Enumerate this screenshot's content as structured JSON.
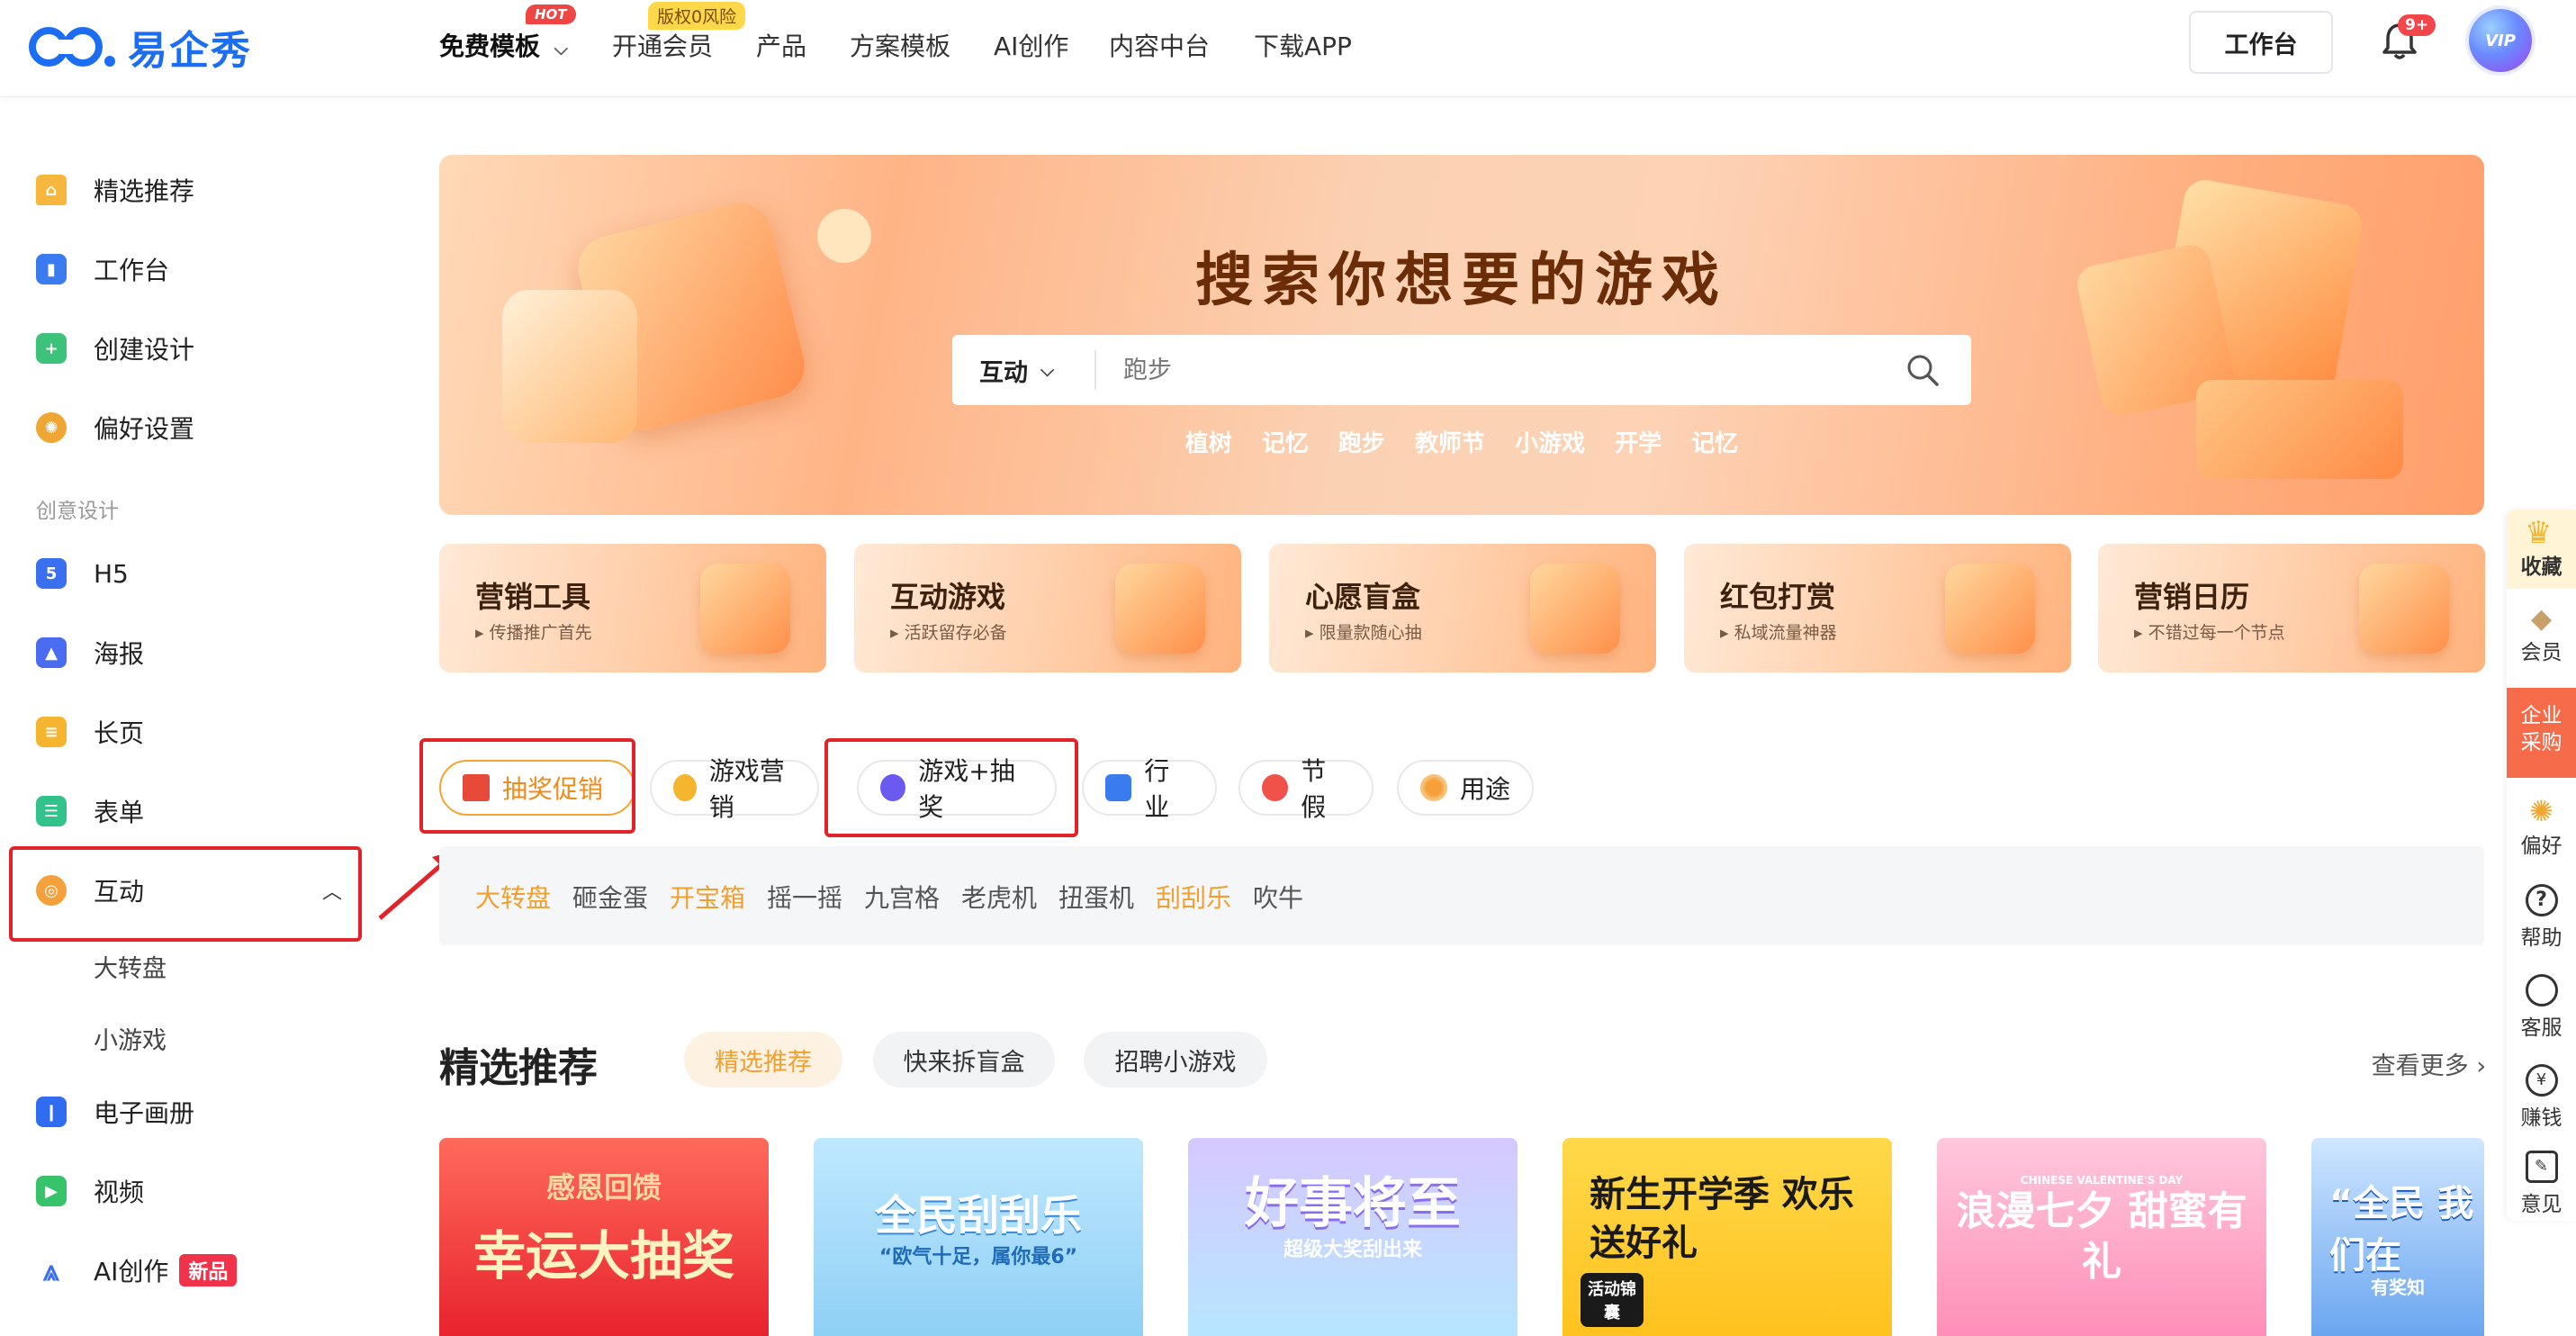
{
  "header": {
    "logo_text": "易企秀",
    "nav": [
      {
        "label": "免费模板",
        "badge": "HOT"
      },
      {
        "label": "开通会员",
        "badge": "版权0风险"
      },
      {
        "label": "产品"
      },
      {
        "label": "方案模板"
      },
      {
        "label": "AI创作"
      },
      {
        "label": "内容中台"
      },
      {
        "label": "下载APP"
      }
    ],
    "workbench_label": "工作台",
    "notif_count": "9+",
    "avatar_text": "VIP"
  },
  "sidebar": {
    "items": [
      {
        "label": "精选推荐",
        "color": "#f6b73c"
      },
      {
        "label": "工作台",
        "color": "#3a7bf0"
      },
      {
        "label": "创建设计",
        "color": "#3cc27a"
      },
      {
        "label": "偏好设置",
        "color": "#f0a632"
      }
    ],
    "section_label": "创意设计",
    "design_items": [
      {
        "label": "H5",
        "color": "#3a6ff0"
      },
      {
        "label": "海报",
        "color": "#4a6cf0"
      },
      {
        "label": "长页",
        "color": "#f5b52e"
      },
      {
        "label": "表单",
        "color": "#32c38a"
      },
      {
        "label": "互动",
        "color": "#f5a03a"
      }
    ],
    "sub_items": [
      "大转盘",
      "小游戏"
    ],
    "bottom_items": [
      {
        "label": "电子画册",
        "color": "#2f6cf0"
      },
      {
        "label": "视频",
        "color": "#36c36a"
      },
      {
        "label": "AI创作",
        "color": "#3a6ff0",
        "badge": "新品"
      }
    ]
  },
  "banner": {
    "title": "搜索你想要的游戏",
    "search_category": "互动",
    "search_placeholder": "跑步",
    "hot_words": [
      "植树",
      "记忆",
      "跑步",
      "教师节",
      "小游戏",
      "开学",
      "记忆"
    ]
  },
  "feature_cards": [
    {
      "title": "营销工具",
      "subtitle": "▸ 传播推广首先"
    },
    {
      "title": "互动游戏",
      "subtitle": "▸ 活跃留存必备"
    },
    {
      "title": "心愿盲盒",
      "subtitle": "▸ 限量款随心抽"
    },
    {
      "title": "红包打赏",
      "subtitle": "▸ 私域流量神器"
    },
    {
      "title": "营销日历",
      "subtitle": "▸ 不错过每一个节点"
    }
  ],
  "category_pills": [
    {
      "label": "抽奖促销",
      "active": true
    },
    {
      "label": "游戏营销"
    },
    {
      "label": "游戏+抽奖"
    },
    {
      "label": "行业"
    },
    {
      "label": "节假"
    },
    {
      "label": "用途"
    }
  ],
  "sub_categories": [
    "大转盘",
    "砸金蛋",
    "开宝箱",
    "摇一摇",
    "九宫格",
    "老虎机",
    "扭蛋机",
    "刮刮乐",
    "吹牛"
  ],
  "recommend": {
    "title": "精选推荐",
    "tabs": [
      "精选推荐",
      "快来拆盲盒",
      "招聘小游戏"
    ],
    "more": "查看更多 ›",
    "thumbs": [
      {
        "title": "幸运大抽奖",
        "sub": "感恩回馈"
      },
      {
        "title": "全民刮刮乐",
        "sub": "“欧气十足，属你最6”"
      },
      {
        "title": "好事将至",
        "sub": "超级大奖刮出来"
      },
      {
        "title": "新生开学季 欢乐送好礼",
        "sub": "活动锦囊"
      },
      {
        "title": "浪漫七夕 甜蜜有礼",
        "sub": "CHINESE VALENTINE'S DAY"
      },
      {
        "title": "“全民 我们在",
        "sub": "有奖知"
      }
    ]
  },
  "right_rail": [
    "收藏",
    "会员",
    "企业采购",
    "偏好",
    "帮助",
    "客服",
    "赚钱",
    "意见"
  ]
}
